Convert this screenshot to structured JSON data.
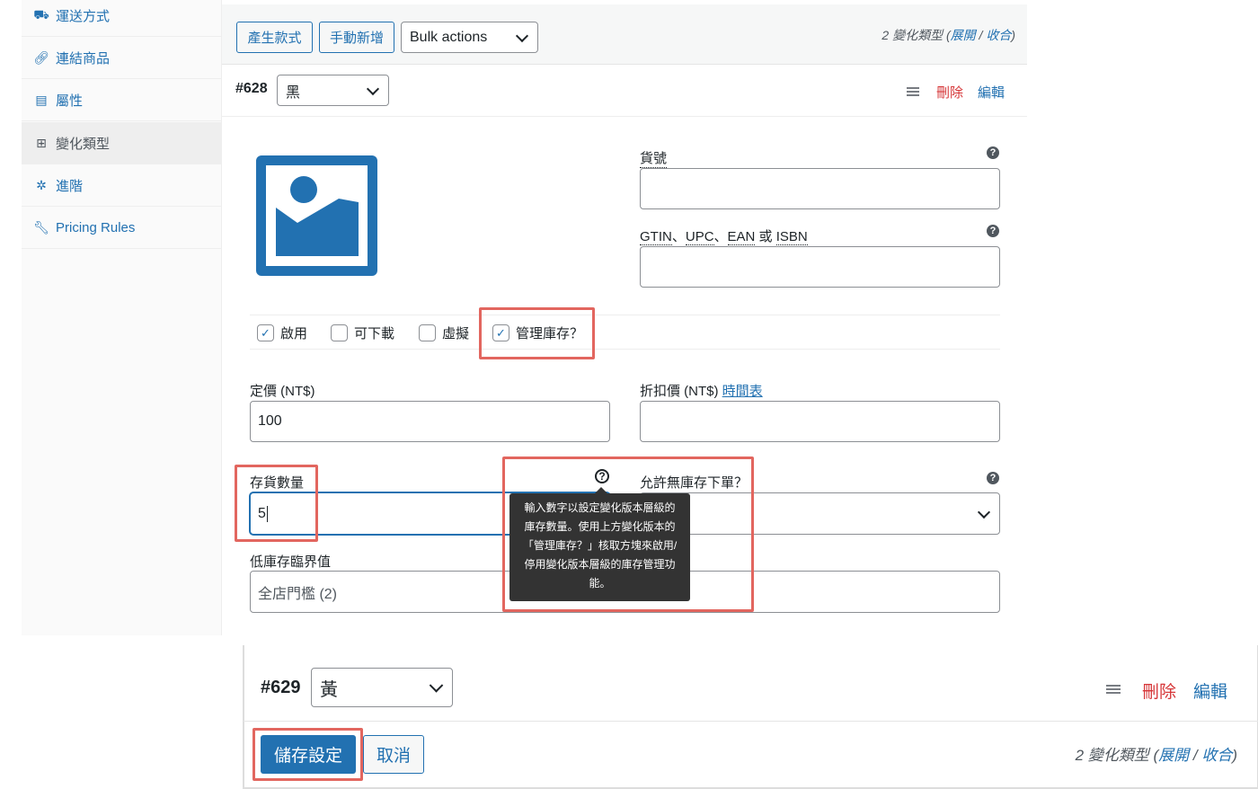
{
  "sidebar": {
    "items": [
      {
        "label": "運送方式",
        "icon": "truck-icon"
      },
      {
        "label": "連結商品",
        "icon": "link-icon"
      },
      {
        "label": "屬性",
        "icon": "list-icon"
      },
      {
        "label": "變化類型",
        "icon": "grid-icon"
      },
      {
        "label": "進階",
        "icon": "gear-icon"
      },
      {
        "label": "Pricing Rules",
        "icon": "wrench-icon"
      }
    ],
    "active_index": 3
  },
  "toolbar": {
    "generate_label": "產生款式",
    "manual_add_label": "手動新增",
    "bulk_actions": "Bulk actions",
    "count_prefix": "2 變化類型 (",
    "expand": "展開",
    "sep": " / ",
    "collapse": "收合",
    "count_suffix": ")"
  },
  "variation_628": {
    "id": "#628",
    "attribute_value": "黑",
    "delete_label": "刪除",
    "edit_label": "編輯",
    "sku_label": "貨號",
    "sku_value": "",
    "gtin_label_parts": [
      "GTIN",
      "、",
      "UPC",
      "、",
      "EAN",
      " 或 ",
      "ISBN"
    ],
    "gtin_value": "",
    "checkboxes": [
      {
        "label": "啟用",
        "checked": true
      },
      {
        "label": "可下載",
        "checked": false
      },
      {
        "label": "虛擬",
        "checked": false
      },
      {
        "label": "管理庫存？",
        "checked": true
      }
    ],
    "regular_price_label": "定價 (NT$)",
    "regular_price_value": "100",
    "sale_price_label": "折扣價 (NT$)",
    "schedule_link": "時間表",
    "sale_price_value": "",
    "stock_qty_label": "存貨數量",
    "stock_qty_value": "5",
    "backorders_label": "允許無庫存下單？",
    "backorders_value": "",
    "low_stock_label": "低庫存臨界值",
    "low_stock_placeholder": "全店門檻 (2)",
    "tooltip_lines": [
      "輸入數字以設定變化版本層級的",
      "庫存數量。使用上方變化版本的",
      "「管理庫存？」核取方塊來啟用/",
      "停用變化版本層級的庫存管理功",
      "能。"
    ]
  },
  "variation_629": {
    "id": "#629",
    "attribute_value": "黃",
    "delete_label": "刪除",
    "edit_label": "編輯"
  },
  "footer": {
    "save_label": "儲存設定",
    "cancel_label": "取消",
    "count_prefix": "2 變化類型 (",
    "expand": "展開",
    "sep": " / ",
    "collapse": "收合",
    "count_suffix": ")"
  },
  "colors": {
    "accent": "#2271b1",
    "danger": "#d63638",
    "highlight": "#e2665f"
  }
}
